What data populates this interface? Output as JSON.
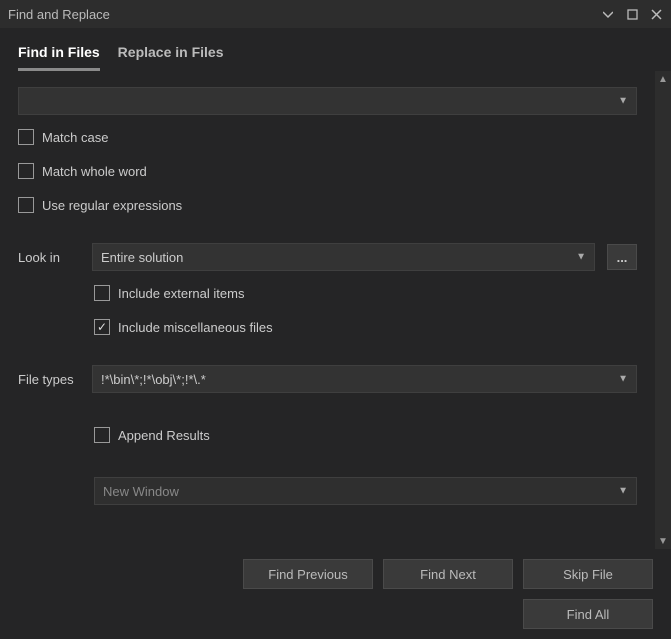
{
  "title": "Find and Replace",
  "tabs": {
    "find": "Find in Files",
    "replace": "Replace in Files"
  },
  "search": {
    "value": ""
  },
  "options": {
    "match_case": "Match case",
    "match_whole_word": "Match whole word",
    "use_regex": "Use regular expressions"
  },
  "look_in": {
    "label": "Look in",
    "value": "Entire solution",
    "browse": "...",
    "include_external": "Include external items",
    "include_misc": "Include miscellaneous files"
  },
  "file_types": {
    "label": "File types",
    "value": "!*\\bin\\*;!*\\obj\\*;!*\\.*"
  },
  "results": {
    "append": "Append Results",
    "window": "New Window"
  },
  "buttons": {
    "find_previous": "Find Previous",
    "find_next": "Find Next",
    "skip_file": "Skip File",
    "find_all": "Find All"
  }
}
